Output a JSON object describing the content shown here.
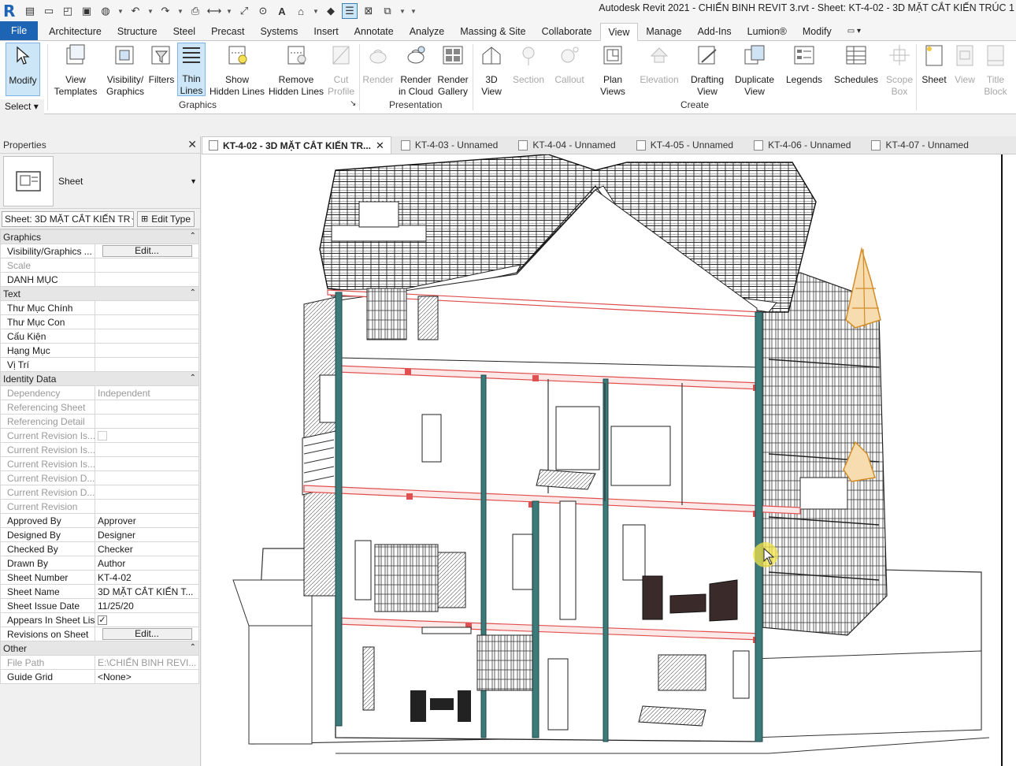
{
  "app": {
    "title": "Autodesk Revit 2021 - CHIẾN BINH REVIT 3.rvt - Sheet: KT-4-02 - 3D MẶT CẮT KIẾN TRÚC 1",
    "logo": "R",
    "accent": "#1e64b4"
  },
  "ribbon_tabs": [
    {
      "label": "File"
    },
    {
      "label": "Architecture"
    },
    {
      "label": "Structure"
    },
    {
      "label": "Steel"
    },
    {
      "label": "Precast"
    },
    {
      "label": "Systems"
    },
    {
      "label": "Insert"
    },
    {
      "label": "Annotate"
    },
    {
      "label": "Analyze"
    },
    {
      "label": "Massing & Site"
    },
    {
      "label": "Collaborate"
    },
    {
      "label": "View"
    },
    {
      "label": "Manage"
    },
    {
      "label": "Add-Ins"
    },
    {
      "label": "Lumion®"
    },
    {
      "label": "Modify"
    }
  ],
  "ribbon": {
    "modify": "Modify",
    "select": "Select",
    "buttons": [
      {
        "l1": "View",
        "l2": "Templates"
      },
      {
        "l1": "Visibility/",
        "l2": "Graphics"
      },
      {
        "l1": "Filters",
        "l2": ""
      },
      {
        "l1": "Thin",
        "l2": "Lines"
      },
      {
        "l1": "Show",
        "l2": "Hidden Lines"
      },
      {
        "l1": "Remove",
        "l2": "Hidden Lines"
      },
      {
        "l1": "Cut",
        "l2": "Profile"
      },
      {
        "l1": "Render",
        "l2": ""
      },
      {
        "l1": "Render",
        "l2": "in Cloud"
      },
      {
        "l1": "Render",
        "l2": "Gallery"
      },
      {
        "l1": "3D",
        "l2": "View"
      },
      {
        "l1": "Section",
        "l2": ""
      },
      {
        "l1": "Callout",
        "l2": ""
      },
      {
        "l1": "Plan",
        "l2": "Views"
      },
      {
        "l1": "Elevation",
        "l2": ""
      },
      {
        "l1": "Drafting",
        "l2": "View"
      },
      {
        "l1": "Duplicate",
        "l2": "View"
      },
      {
        "l1": "Legends",
        "l2": ""
      },
      {
        "l1": "Schedules",
        "l2": ""
      },
      {
        "l1": "Scope",
        "l2": "Box"
      },
      {
        "l1": "Sheet",
        "l2": ""
      },
      {
        "l1": "View",
        "l2": ""
      },
      {
        "l1": "Title",
        "l2": "Block"
      }
    ],
    "panels": {
      "graphics": "Graphics",
      "presentation": "Presentation",
      "create": "Create"
    }
  },
  "properties": {
    "title": "Properties",
    "type_name": "Sheet",
    "filter_value": "Sheet: 3D MẶT CẮT KIẾN TR",
    "edit_type": "Edit Type",
    "groups": {
      "graphics": "Graphics",
      "text": "Text",
      "identity": "Identity Data",
      "other": "Other"
    },
    "rows": {
      "vis_graphics": {
        "k": "Visibility/Graphics ...",
        "v": "Edit..."
      },
      "scale": {
        "k": "Scale",
        "v": ""
      },
      "danh_muc": {
        "k": "DANH MỤC",
        "v": ""
      },
      "thu_muc_chinh": {
        "k": "Thư Mục Chính",
        "v": ""
      },
      "thu_muc_con": {
        "k": "Thư Mục Con",
        "v": ""
      },
      "cau_kien": {
        "k": "Cấu Kiện",
        "v": ""
      },
      "hang_muc": {
        "k": "Hạng Mục",
        "v": ""
      },
      "vi_tri": {
        "k": "Vị Trí",
        "v": ""
      },
      "dependency": {
        "k": "Dependency",
        "v": "Independent"
      },
      "ref_sheet": {
        "k": "Referencing Sheet",
        "v": ""
      },
      "ref_detail": {
        "k": "Referencing Detail",
        "v": ""
      },
      "cur_rev_1": {
        "k": "Current Revision Is...",
        "v": ""
      },
      "cur_rev_2": {
        "k": "Current Revision Is...",
        "v": ""
      },
      "cur_rev_3": {
        "k": "Current Revision Is...",
        "v": ""
      },
      "cur_rev_d1": {
        "k": "Current Revision D...",
        "v": ""
      },
      "cur_rev_d2": {
        "k": "Current Revision D...",
        "v": ""
      },
      "cur_rev": {
        "k": "Current Revision",
        "v": ""
      },
      "approved_by": {
        "k": "Approved By",
        "v": "Approver"
      },
      "designed_by": {
        "k": "Designed By",
        "v": "Designer"
      },
      "checked_by": {
        "k": "Checked By",
        "v": "Checker"
      },
      "drawn_by": {
        "k": "Drawn By",
        "v": "Author"
      },
      "sheet_number": {
        "k": "Sheet Number",
        "v": "KT-4-02"
      },
      "sheet_name": {
        "k": "Sheet Name",
        "v": "3D MẶT CẮT KIẾN T..."
      },
      "sheet_issue_date": {
        "k": "Sheet Issue Date",
        "v": "11/25/20"
      },
      "appears_in_list": {
        "k": "Appears In Sheet List",
        "v": "✓"
      },
      "revisions_on_sheet": {
        "k": "Revisions on Sheet",
        "v": "Edit..."
      },
      "file_path": {
        "k": "File Path",
        "v": "E:\\CHIẾN BINH REVI..."
      },
      "guide_grid": {
        "k": "Guide Grid",
        "v": "<None>"
      }
    }
  },
  "view_tabs": [
    {
      "label": "KT-4-02 - 3D MẶT CẮT KIẾN TR...",
      "active": true
    },
    {
      "label": "KT-4-03 - Unnamed"
    },
    {
      "label": "KT-4-04 - Unnamed"
    },
    {
      "label": "KT-4-05 - Unnamed"
    },
    {
      "label": "KT-4-06 - Unnamed"
    },
    {
      "label": "KT-4-07 - Unnamed"
    }
  ],
  "colors": {
    "section_cut": "#e05050",
    "column": "#3d7a7a",
    "ornament": "#d28c28"
  }
}
